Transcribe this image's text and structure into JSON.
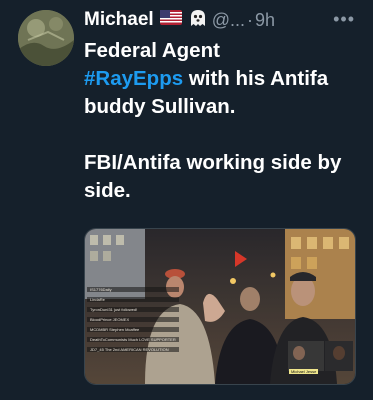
{
  "tweet": {
    "author_name": "Michael",
    "handle": "@...",
    "separator": "·",
    "time": "9h",
    "more_icon": "more-icon",
    "text_line1": "Federal Agent",
    "hashtag": "#RayEpps",
    "text_line2_rest": " with his Antifa buddy Sullivan.",
    "text_para2": "FBI/Antifa working side by side."
  },
  "media": {
    "overlay_lines": [
      "IS1776Daily",
      "LindaRe",
      "TyronDunI31  just followed!",
      "BloodPrince  JEOMEX",
      "MCDMBR  Stephen Mcaffee",
      "DeathToCommunists  Much LOVE SUPPORTER",
      "JD7_45  The 2nd AMERICAN REVOLUTION"
    ],
    "thumb_label": "Michael Jesse"
  },
  "colors": {
    "background": "#15202b",
    "text": "#ffffff",
    "secondary": "#8b98a5",
    "hashtag": "#1d9bf0"
  }
}
